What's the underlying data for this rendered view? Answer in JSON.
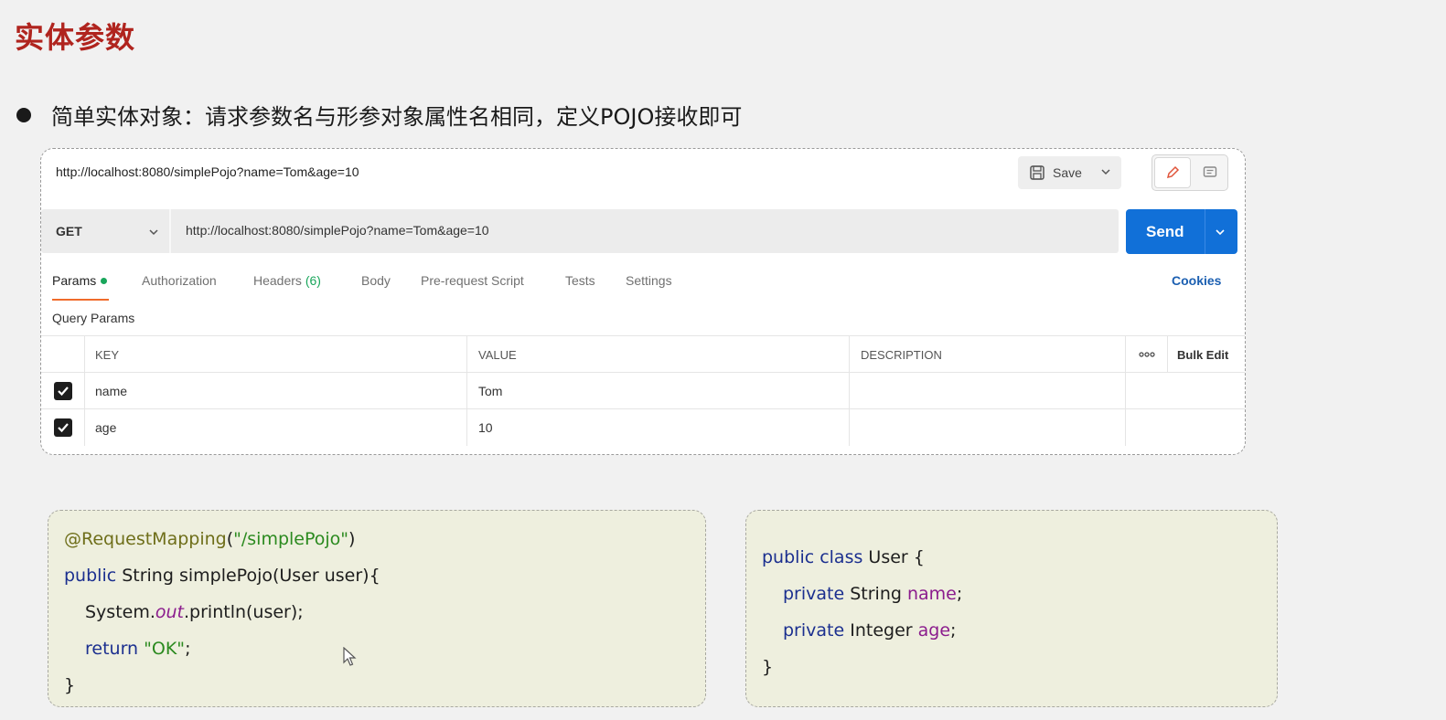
{
  "slide": {
    "title": "实体参数",
    "bullet": "简单实体对象：请求参数名与形参对象属性名相同，定义POJO接收即可"
  },
  "postman": {
    "top_url": "http://localhost:8080/simplePojo?name=Tom&age=10",
    "save_label": "Save",
    "method": "GET",
    "request_url": "http://localhost:8080/simplePojo?name=Tom&age=10",
    "send_label": "Send",
    "tabs": [
      {
        "label": "Params",
        "active": true
      },
      {
        "label": "Authorization"
      },
      {
        "label": "Headers",
        "count": "(6)"
      },
      {
        "label": "Body"
      },
      {
        "label": "Pre-request Script"
      },
      {
        "label": "Tests"
      },
      {
        "label": "Settings"
      }
    ],
    "cookies_label": "Cookies",
    "query_params_label": "Query Params",
    "table": {
      "headers": {
        "key": "KEY",
        "value": "VALUE",
        "description": "DESCRIPTION",
        "more": "ooo",
        "bulk_edit": "Bulk Edit"
      },
      "rows": [
        {
          "checked": true,
          "key": "name",
          "value": "Tom",
          "description": ""
        },
        {
          "checked": true,
          "key": "age",
          "value": "10",
          "description": ""
        }
      ]
    }
  },
  "code_left": {
    "annotation": "@RequestMapping",
    "annotation_arg": "\"/simplePojo\"",
    "l2_kw": "public",
    "l2_rest": " String simplePojo(User user){",
    "l3_a": "System.",
    "l3_field": "out",
    "l3_b": ".println(user);",
    "l4_kw": "return",
    "l4_str": "\"OK\"",
    "close": "}"
  },
  "code_right": {
    "l1_kw": "public class",
    "l1_rest": " User {",
    "l2_kw": "private",
    "l2_type": " String ",
    "l2_field": "name",
    "l3_kw": "private",
    "l3_type": " Integer ",
    "l3_field": "age",
    "close": "}"
  },
  "colors": {
    "title": "#b0241e",
    "send_button": "#1170d8",
    "active_tab_underline": "#f06b2b",
    "params_dot": "#19a65b",
    "code_background": "#eeefde"
  }
}
